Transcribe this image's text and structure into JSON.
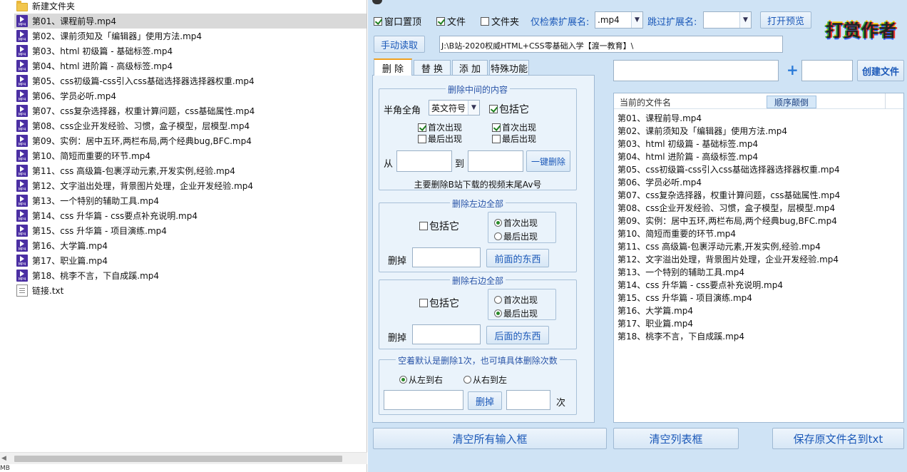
{
  "explorer": {
    "items": [
      {
        "name": "新建文件夹",
        "type": "folder"
      },
      {
        "name": "第01、课程前导.mp4",
        "type": "mp4",
        "selected": true
      },
      {
        "name": "第02、课前须知及「编辑器」使用方法.mp4",
        "type": "mp4"
      },
      {
        "name": "第03、html 初级篇 - 基础标签.mp4",
        "type": "mp4"
      },
      {
        "name": "第04、html 进阶篇 - 高级标签.mp4",
        "type": "mp4"
      },
      {
        "name": "第05、css初级篇-css引入css基础选择器选择器权重.mp4",
        "type": "mp4"
      },
      {
        "name": "第06、学员必听.mp4",
        "type": "mp4"
      },
      {
        "name": "第07、css复杂选择器，权重计算问题，css基础属性.mp4",
        "type": "mp4"
      },
      {
        "name": "第08、css企业开发经验、习惯，盒子模型，层模型.mp4",
        "type": "mp4"
      },
      {
        "name": "第09、实例：居中五环,两栏布局,两个经典bug,BFC.mp4",
        "type": "mp4"
      },
      {
        "name": "第10、简短而重要的环节.mp4",
        "type": "mp4"
      },
      {
        "name": "第11、css 高级篇-包裹浮动元素,开发实例,经验.mp4",
        "type": "mp4"
      },
      {
        "name": "第12、文字溢出处理，背景图片处理，企业开发经验.mp4",
        "type": "mp4"
      },
      {
        "name": "第13、一个特别的辅助工具.mp4",
        "type": "mp4"
      },
      {
        "name": "第14、css 升华篇 - css要点补充说明.mp4",
        "type": "mp4"
      },
      {
        "name": "第15、css 升华篇 - 项目演练.mp4",
        "type": "mp4"
      },
      {
        "name": "第16、大学篇.mp4",
        "type": "mp4"
      },
      {
        "name": "第17、职业篇.mp4",
        "type": "mp4"
      },
      {
        "name": "第18、桃李不言，下自成蹊.mp4",
        "type": "mp4"
      },
      {
        "name": "链接.txt",
        "type": "txt"
      }
    ],
    "status": "MB"
  },
  "app": {
    "top": {
      "window_on_top": {
        "label": "窗口置顶",
        "checked": true
      },
      "files": {
        "label": "文件",
        "checked": true
      },
      "folders": {
        "label": "文件夹",
        "checked": false
      },
      "ext_filter_label": "仅检索扩展名:",
      "ext_filter_value": ".mp4",
      "skip_ext_label": "跳过扩展名:",
      "skip_ext_value": "",
      "open_preview": "打开预览",
      "manual_read": "手动读取",
      "path": "J:\\B站-2020权威HTML+CSS零基础入学【渡一教育】\\",
      "logo_text": "打赏作者"
    },
    "tabs": [
      "删 除",
      "替 换",
      "添 加",
      "特殊功能"
    ],
    "delete_middle": {
      "title": "删除中间的内容",
      "width_label": "半角全角",
      "width_value": "英文符号",
      "include": {
        "label": "包括它",
        "checked": true
      },
      "left_first": {
        "label": "首次出现",
        "checked": true
      },
      "left_last": {
        "label": "最后出现",
        "checked": false
      },
      "right_first": {
        "label": "首次出现",
        "checked": true
      },
      "right_last": {
        "label": "最后出现",
        "checked": false
      },
      "from_label": "从",
      "to_label": "到",
      "button": "一键删除",
      "note": "主要删除B站下载的视频末尾Av号"
    },
    "delete_left": {
      "title": "删除左边全部",
      "include": {
        "label": "包括它",
        "checked": false
      },
      "first": {
        "label": "首次出现",
        "checked": true
      },
      "last": {
        "label": "最后出现",
        "checked": false
      },
      "remove_label": "删掉",
      "button": "前面的东西"
    },
    "delete_right": {
      "title": "删除右边全部",
      "include": {
        "label": "包括它",
        "checked": false
      },
      "first": {
        "label": "首次出现",
        "checked": false
      },
      "last": {
        "label": "最后出现",
        "checked": true
      },
      "remove_label": "删掉",
      "button": "后面的东西"
    },
    "delete_count": {
      "title": "空着默认是删除1次，也可填具体删除次数",
      "ltr": {
        "label": "从左到右",
        "checked": true
      },
      "rtl": {
        "label": "从右到左",
        "checked": false
      },
      "button": "删掉",
      "unit": "次"
    },
    "create": {
      "plus": "+",
      "button": "创建文件"
    },
    "list": {
      "header": "当前的文件名",
      "sort_button": "顺序颠倒",
      "items": [
        "第01、课程前导.mp4",
        "第02、课前须知及「编辑器」使用方法.mp4",
        "第03、html 初级篇 - 基础标签.mp4",
        "第04、html 进阶篇 - 高级标签.mp4",
        "第05、css初级篇-css引入css基础选择器选择器权重.mp4",
        "第06、学员必听.mp4",
        "第07、css复杂选择器，权重计算问题，css基础属性.mp4",
        "第08、css企业开发经验、习惯，盒子模型，层模型.mp4",
        "第09、实例：居中五环,两栏布局,两个经典bug,BFC.mp4",
        "第10、简短而重要的环节.mp4",
        "第11、css 高级篇-包裹浮动元素,开发实例,经验.mp4",
        "第12、文字溢出处理，背景图片处理，企业开发经验.mp4",
        "第13、一个特别的辅助工具.mp4",
        "第14、css 升华篇 - css要点补充说明.mp4",
        "第15、css 升华篇 - 项目演练.mp4",
        "第16、大学篇.mp4",
        "第17、职业篇.mp4",
        "第18、桃李不言，下自成蹊.mp4"
      ]
    },
    "bottom": {
      "clear_inputs": "清空所有输入框",
      "clear_list": "清空列表框",
      "save_names": "保存原文件名到txt"
    }
  }
}
